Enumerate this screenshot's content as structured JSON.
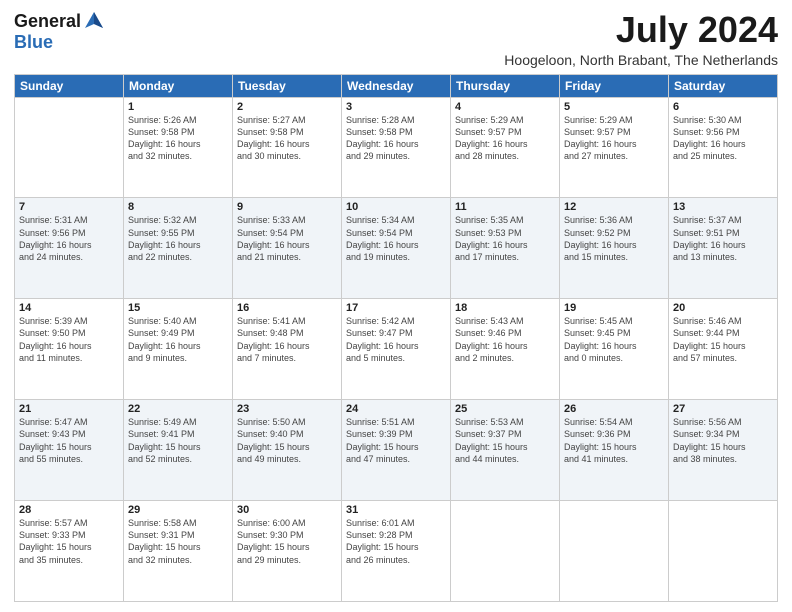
{
  "header": {
    "logo_general": "General",
    "logo_blue": "Blue",
    "month_title": "July 2024",
    "location": "Hoogeloon, North Brabant, The Netherlands"
  },
  "weekdays": [
    "Sunday",
    "Monday",
    "Tuesday",
    "Wednesday",
    "Thursday",
    "Friday",
    "Saturday"
  ],
  "weeks": [
    [
      {
        "day": "",
        "info": ""
      },
      {
        "day": "1",
        "info": "Sunrise: 5:26 AM\nSunset: 9:58 PM\nDaylight: 16 hours\nand 32 minutes."
      },
      {
        "day": "2",
        "info": "Sunrise: 5:27 AM\nSunset: 9:58 PM\nDaylight: 16 hours\nand 30 minutes."
      },
      {
        "day": "3",
        "info": "Sunrise: 5:28 AM\nSunset: 9:58 PM\nDaylight: 16 hours\nand 29 minutes."
      },
      {
        "day": "4",
        "info": "Sunrise: 5:29 AM\nSunset: 9:57 PM\nDaylight: 16 hours\nand 28 minutes."
      },
      {
        "day": "5",
        "info": "Sunrise: 5:29 AM\nSunset: 9:57 PM\nDaylight: 16 hours\nand 27 minutes."
      },
      {
        "day": "6",
        "info": "Sunrise: 5:30 AM\nSunset: 9:56 PM\nDaylight: 16 hours\nand 25 minutes."
      }
    ],
    [
      {
        "day": "7",
        "info": "Sunrise: 5:31 AM\nSunset: 9:56 PM\nDaylight: 16 hours\nand 24 minutes."
      },
      {
        "day": "8",
        "info": "Sunrise: 5:32 AM\nSunset: 9:55 PM\nDaylight: 16 hours\nand 22 minutes."
      },
      {
        "day": "9",
        "info": "Sunrise: 5:33 AM\nSunset: 9:54 PM\nDaylight: 16 hours\nand 21 minutes."
      },
      {
        "day": "10",
        "info": "Sunrise: 5:34 AM\nSunset: 9:54 PM\nDaylight: 16 hours\nand 19 minutes."
      },
      {
        "day": "11",
        "info": "Sunrise: 5:35 AM\nSunset: 9:53 PM\nDaylight: 16 hours\nand 17 minutes."
      },
      {
        "day": "12",
        "info": "Sunrise: 5:36 AM\nSunset: 9:52 PM\nDaylight: 16 hours\nand 15 minutes."
      },
      {
        "day": "13",
        "info": "Sunrise: 5:37 AM\nSunset: 9:51 PM\nDaylight: 16 hours\nand 13 minutes."
      }
    ],
    [
      {
        "day": "14",
        "info": "Sunrise: 5:39 AM\nSunset: 9:50 PM\nDaylight: 16 hours\nand 11 minutes."
      },
      {
        "day": "15",
        "info": "Sunrise: 5:40 AM\nSunset: 9:49 PM\nDaylight: 16 hours\nand 9 minutes."
      },
      {
        "day": "16",
        "info": "Sunrise: 5:41 AM\nSunset: 9:48 PM\nDaylight: 16 hours\nand 7 minutes."
      },
      {
        "day": "17",
        "info": "Sunrise: 5:42 AM\nSunset: 9:47 PM\nDaylight: 16 hours\nand 5 minutes."
      },
      {
        "day": "18",
        "info": "Sunrise: 5:43 AM\nSunset: 9:46 PM\nDaylight: 16 hours\nand 2 minutes."
      },
      {
        "day": "19",
        "info": "Sunrise: 5:45 AM\nSunset: 9:45 PM\nDaylight: 16 hours\nand 0 minutes."
      },
      {
        "day": "20",
        "info": "Sunrise: 5:46 AM\nSunset: 9:44 PM\nDaylight: 15 hours\nand 57 minutes."
      }
    ],
    [
      {
        "day": "21",
        "info": "Sunrise: 5:47 AM\nSunset: 9:43 PM\nDaylight: 15 hours\nand 55 minutes."
      },
      {
        "day": "22",
        "info": "Sunrise: 5:49 AM\nSunset: 9:41 PM\nDaylight: 15 hours\nand 52 minutes."
      },
      {
        "day": "23",
        "info": "Sunrise: 5:50 AM\nSunset: 9:40 PM\nDaylight: 15 hours\nand 49 minutes."
      },
      {
        "day": "24",
        "info": "Sunrise: 5:51 AM\nSunset: 9:39 PM\nDaylight: 15 hours\nand 47 minutes."
      },
      {
        "day": "25",
        "info": "Sunrise: 5:53 AM\nSunset: 9:37 PM\nDaylight: 15 hours\nand 44 minutes."
      },
      {
        "day": "26",
        "info": "Sunrise: 5:54 AM\nSunset: 9:36 PM\nDaylight: 15 hours\nand 41 minutes."
      },
      {
        "day": "27",
        "info": "Sunrise: 5:56 AM\nSunset: 9:34 PM\nDaylight: 15 hours\nand 38 minutes."
      }
    ],
    [
      {
        "day": "28",
        "info": "Sunrise: 5:57 AM\nSunset: 9:33 PM\nDaylight: 15 hours\nand 35 minutes."
      },
      {
        "day": "29",
        "info": "Sunrise: 5:58 AM\nSunset: 9:31 PM\nDaylight: 15 hours\nand 32 minutes."
      },
      {
        "day": "30",
        "info": "Sunrise: 6:00 AM\nSunset: 9:30 PM\nDaylight: 15 hours\nand 29 minutes."
      },
      {
        "day": "31",
        "info": "Sunrise: 6:01 AM\nSunset: 9:28 PM\nDaylight: 15 hours\nand 26 minutes."
      },
      {
        "day": "",
        "info": ""
      },
      {
        "day": "",
        "info": ""
      },
      {
        "day": "",
        "info": ""
      }
    ]
  ]
}
